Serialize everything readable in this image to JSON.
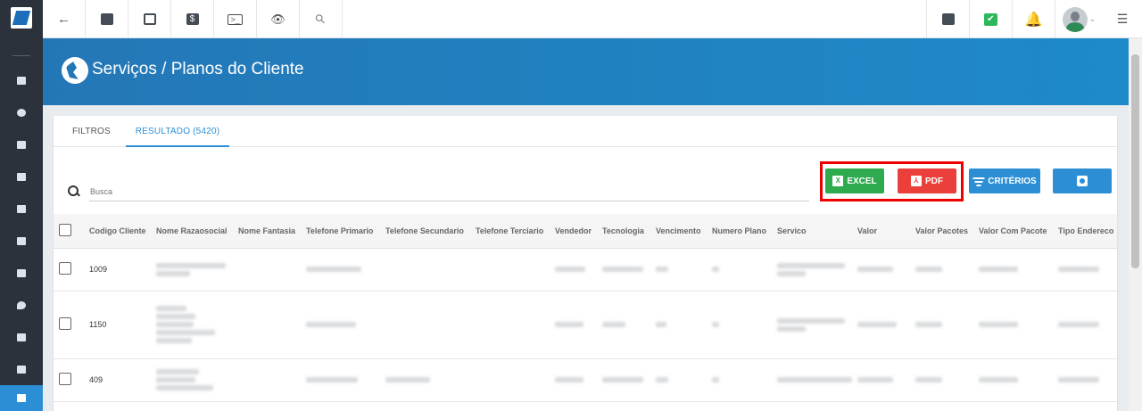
{
  "app": {
    "logo_icon": "brand-logo-icon"
  },
  "sidebar": {
    "items": [
      {
        "icon": "dashboard-icon"
      },
      {
        "icon": "globe-icon"
      },
      {
        "icon": "id-card-icon"
      },
      {
        "icon": "storefront-icon"
      },
      {
        "icon": "calendar-clock-icon"
      },
      {
        "icon": "box-icon"
      },
      {
        "icon": "money-icon"
      },
      {
        "icon": "map-pin-icon"
      },
      {
        "icon": "list-icon"
      },
      {
        "icon": "server-icon"
      },
      {
        "icon": "document-icon"
      }
    ],
    "active_index": 10
  },
  "topbar": {
    "left": [
      "back-arrow-icon",
      "contact-card-icon",
      "calendar-clock-icon",
      "dollar-icon",
      "terminal-icon",
      "eye-icon",
      "search-icon"
    ],
    "right": [
      "pdf-icon",
      "check-icon",
      "alarm-bell-icon",
      "avatar",
      "menu-list-icon"
    ],
    "back_glyph": "←",
    "dollar_glyph": "$",
    "terminal_glyph": ">_",
    "eye_glyph": "👁",
    "search_glyph": "⚲",
    "check_glyph": "✔",
    "bell_glyph": "🔔",
    "menu_glyph": "☰",
    "avatar_caret": "⌄"
  },
  "page": {
    "title": "Serviços / Planos do Cliente"
  },
  "tabs": [
    {
      "label": "FILTROS",
      "active": false
    },
    {
      "label": "RESULTADO (5420)",
      "active": true
    }
  ],
  "search": {
    "placeholder": "Busca"
  },
  "actions": {
    "excel_label": "EXCEL",
    "excel_glyph": "X",
    "pdf_label": "PDF",
    "pdf_glyph": "⅄",
    "criteria_label": "CRITÉRIOS"
  },
  "table": {
    "columns": [
      "Codigo Cliente",
      "Nome Razaosocial",
      "Nome Fantasia",
      "Telefone Primario",
      "Telefone Secundario",
      "Telefone Terciario",
      "Vendedor",
      "Tecnologia",
      "Vencimento",
      "Numero Plano",
      "Servico",
      "Valor",
      "Valor Pacotes",
      "Valor Com Pacote",
      "Tipo Endereco"
    ],
    "rows": [
      {
        "codigo": "1009"
      },
      {
        "codigo": "1150"
      },
      {
        "codigo": "409"
      }
    ]
  },
  "colors": {
    "primary": "#2c8fd6",
    "excel": "#2eab4e",
    "pdf": "#ea3f3a",
    "sidebar": "#2b323c",
    "highlight_box": "#ee0000"
  }
}
